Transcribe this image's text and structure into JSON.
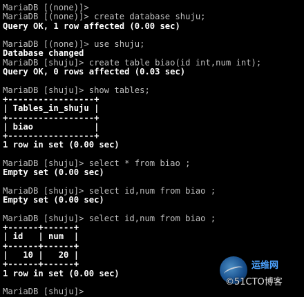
{
  "terminal": {
    "lines": [
      {
        "kind": "prompt",
        "text": "MariaDB [(none)]>"
      },
      {
        "kind": "prompt",
        "text": "MariaDB [(none)]> create database shuju;"
      },
      {
        "kind": "output",
        "text": "Query OK, 1 row affected (0.00 sec)"
      },
      {
        "kind": "blank",
        "text": ""
      },
      {
        "kind": "prompt",
        "text": "MariaDB [(none)]> use shuju;"
      },
      {
        "kind": "output",
        "text": "Database changed"
      },
      {
        "kind": "prompt",
        "text": "MariaDB [shuju]> create table biao(id int,num int);"
      },
      {
        "kind": "output",
        "text": "Query OK, 0 rows affected (0.03 sec)"
      },
      {
        "kind": "blank",
        "text": ""
      },
      {
        "kind": "prompt",
        "text": "MariaDB [shuju]> show tables;"
      },
      {
        "kind": "output",
        "text": "+-----------------+"
      },
      {
        "kind": "output",
        "text": "| Tables_in_shuju |"
      },
      {
        "kind": "output",
        "text": "+-----------------+"
      },
      {
        "kind": "output",
        "text": "| biao            |"
      },
      {
        "kind": "output",
        "text": "+-----------------+"
      },
      {
        "kind": "output",
        "text": "1 row in set (0.00 sec)"
      },
      {
        "kind": "blank",
        "text": ""
      },
      {
        "kind": "prompt",
        "text": "MariaDB [shuju]> select * from biao ;"
      },
      {
        "kind": "output",
        "text": "Empty set (0.00 sec)"
      },
      {
        "kind": "blank",
        "text": ""
      },
      {
        "kind": "prompt",
        "text": "MariaDB [shuju]> select id,num from biao ;"
      },
      {
        "kind": "output",
        "text": "Empty set (0.00 sec)"
      },
      {
        "kind": "blank",
        "text": ""
      },
      {
        "kind": "prompt",
        "text": "MariaDB [shuju]> select id,num from biao ;"
      },
      {
        "kind": "output",
        "text": "+------+------+"
      },
      {
        "kind": "output",
        "text": "| id   | num  |"
      },
      {
        "kind": "output",
        "text": "+------+------+"
      },
      {
        "kind": "output",
        "text": "|   10 |   20 |"
      },
      {
        "kind": "output",
        "text": "+------+------+"
      },
      {
        "kind": "output",
        "text": "1 row in set (0.00 sec)"
      },
      {
        "kind": "blank",
        "text": ""
      },
      {
        "kind": "prompt",
        "text": "MariaDB [shuju]>"
      }
    ]
  },
  "watermark": {
    "title": "运维网",
    "brand": "©51CTO博客"
  },
  "colors": {
    "background": "#000000",
    "prompt_text": "#c0c0c0",
    "output_text": "#ffffff",
    "watermark_accent": "#4da3ff"
  }
}
